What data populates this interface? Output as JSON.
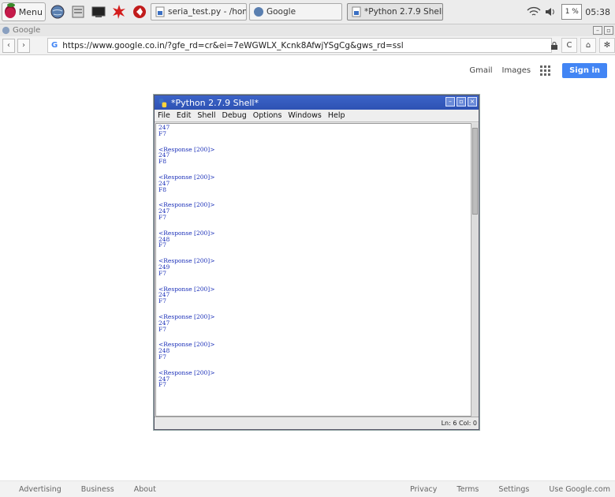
{
  "taskbar": {
    "menu_label": "Menu",
    "tasks": [
      {
        "label": "seria_test.py - /home/...",
        "active": false
      },
      {
        "label": "Google",
        "active": false
      },
      {
        "label": "*Python 2.7.9 Shell*",
        "active": true
      }
    ],
    "cpu": "1 %",
    "clock": "05:38"
  },
  "browser": {
    "window_title": "Google",
    "url": "https://www.google.co.in/?gfe_rd=cr&ei=7eWGWLX_Kcnk8AfwjYSgCg&gws_rd=ssl",
    "header_links": [
      "Gmail",
      "Images"
    ],
    "sign_in": "Sign in",
    "footer_left": [
      "Advertising",
      "Business",
      "About"
    ],
    "footer_right": [
      "Privacy",
      "Terms",
      "Settings",
      "Use Google.com"
    ]
  },
  "shell": {
    "title": "*Python 2.7.9 Shell*",
    "menu": [
      "File",
      "Edit",
      "Shell",
      "Debug",
      "Options",
      "Windows",
      "Help"
    ],
    "output": [
      "247",
      "F7",
      "",
      "<Response [200]>",
      "247",
      "F8",
      "",
      "<Response [200]>",
      "247",
      "F8",
      "",
      "<Response [200]>",
      "247",
      "F7",
      "",
      "<Response [200]>",
      "248",
      "F7",
      "",
      "<Response [200]>",
      "249",
      "F7",
      "",
      "<Response [200]>",
      "247",
      "F7",
      "",
      "<Response [200]>",
      "247",
      "F7",
      "",
      "<Response [200]>",
      "248",
      "F7",
      "",
      "<Response [200]>",
      "247",
      "F7"
    ],
    "status": "Ln: 6 Col: 0"
  }
}
